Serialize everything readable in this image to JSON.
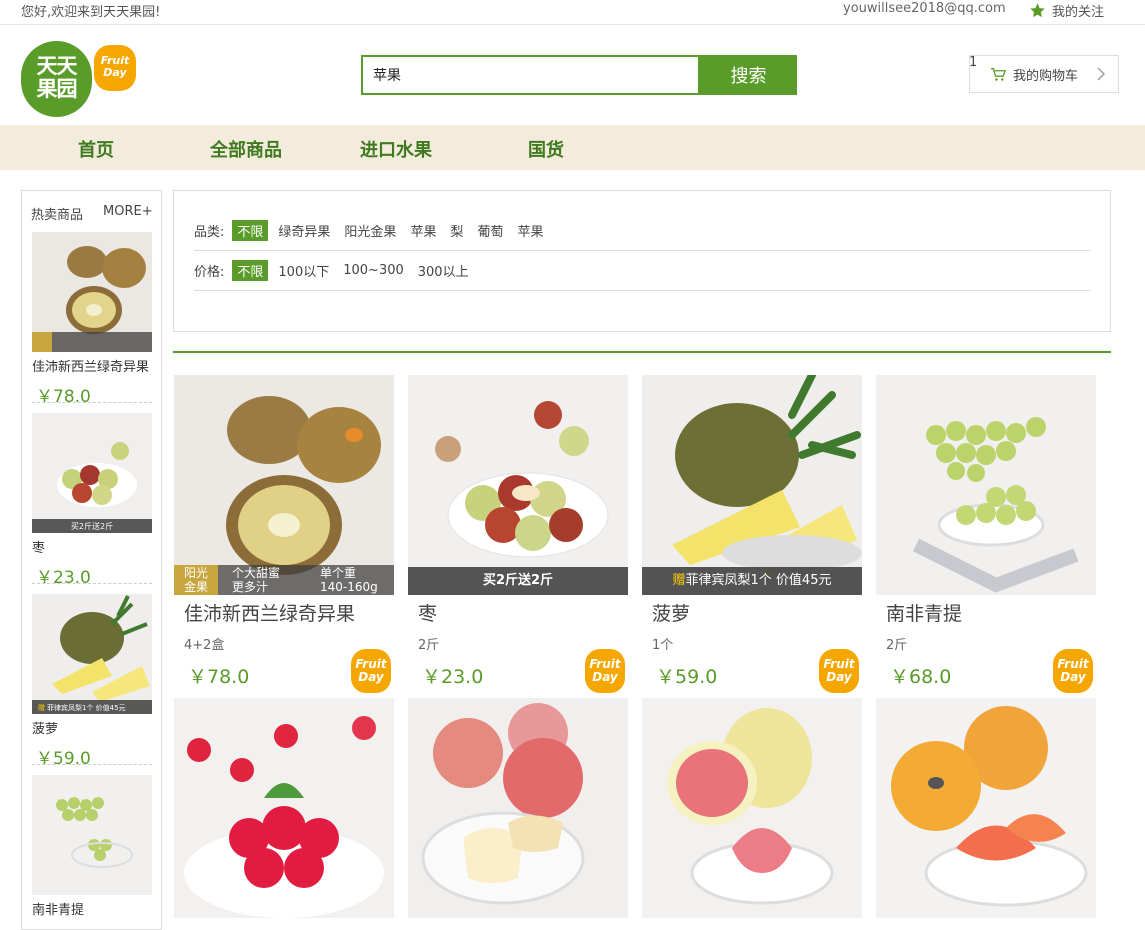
{
  "topbar": {
    "welcome": "您好,欢迎来到天天果园!",
    "email": "youwillsee2018@qq.com",
    "favorites": "我的关注"
  },
  "logo": {
    "line1": "天天",
    "line2": "果园",
    "fruit": "Fruit",
    "day": "Day"
  },
  "search": {
    "value": "苹果",
    "button": "搜索"
  },
  "cart": {
    "label": "我的购物车",
    "count": "1"
  },
  "nav": [
    "首页",
    "全部商品",
    "进口水果",
    "国货"
  ],
  "sidebar": {
    "title": "热卖商品",
    "more": "MORE+",
    "items": [
      {
        "name": "佳沛新西兰绿奇异果",
        "price": "￥78.0"
      },
      {
        "name": "枣",
        "price": "￥23.0",
        "ribbon": "买2斤送2斤"
      },
      {
        "name": "菠萝",
        "price": "￥59.0",
        "ribbon_gift": "赠",
        "ribbon": "菲律宾凤梨1个 价值45元"
      },
      {
        "name": "南非青提"
      }
    ]
  },
  "filter": {
    "category_label": "品类:",
    "category_selected": "不限",
    "categories": [
      "绿奇异果",
      "阳光金果",
      "苹果",
      "梨",
      "葡萄",
      "苹果"
    ],
    "price_label": "价格:",
    "price_selected": "不限",
    "prices": [
      "100以下",
      "100~300",
      "300以上"
    ]
  },
  "products": [
    {
      "name": "佳沛新西兰绿奇异果",
      "unit": "4+2盒",
      "price": "￥78.0",
      "tag1": "阳光",
      "tag2": "金果",
      "tag3": "个大甜蜜",
      "tag4": "更多汁",
      "tag5": "单个重",
      "tag6": "140-160g"
    },
    {
      "name": "枣",
      "unit": "2斤",
      "price": "￥23.0",
      "ribbon": "买2斤送2斤"
    },
    {
      "name": "菠萝",
      "unit": "1个",
      "price": "￥59.0",
      "ribbon_gift": "赠",
      "ribbon": "菲律宾凤梨1个 价值45元"
    },
    {
      "name": "南非青提",
      "unit": "2斤",
      "price": "￥68.0"
    }
  ],
  "badge": {
    "fruit": "Fruit",
    "day": "Day"
  },
  "colors": {
    "brand_green": "#5a9c2a",
    "nav_bg": "#f3ecdc",
    "badge_orange": "#f5a700"
  }
}
